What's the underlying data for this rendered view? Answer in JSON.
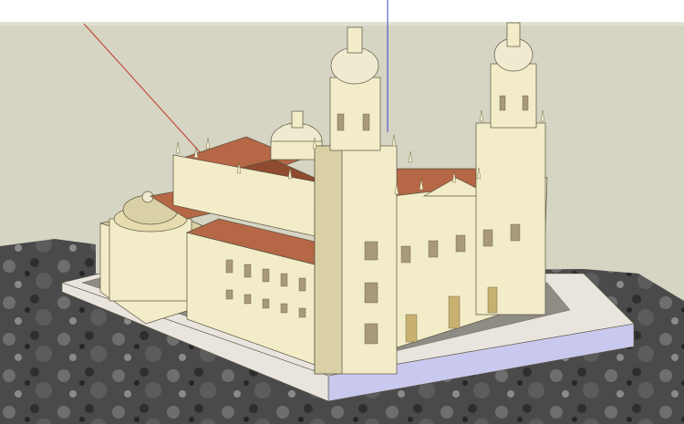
{
  "viewport": {
    "colors": {
      "sky": "#ffffff",
      "horizon": "#e1e1d3",
      "ground_plane": "#d6d4c3",
      "terrain": "#4a4a4a",
      "wall": "#f2ecc8",
      "wall_shadow": "#d9d0a6",
      "wall_dark": "#c4ba8d",
      "roof": "#b56746",
      "roof_dark": "#8f4a30",
      "dome": "#f0ead0",
      "pavement": "#8f8c85",
      "plinth_top": "#e9e5de",
      "plinth_side": "#c9c8ee",
      "edge": "#5a5540",
      "window": "#a8997a",
      "door": "#c8b070",
      "axis_red": "#c0392b",
      "axis_blue": "#3a46c8"
    }
  }
}
